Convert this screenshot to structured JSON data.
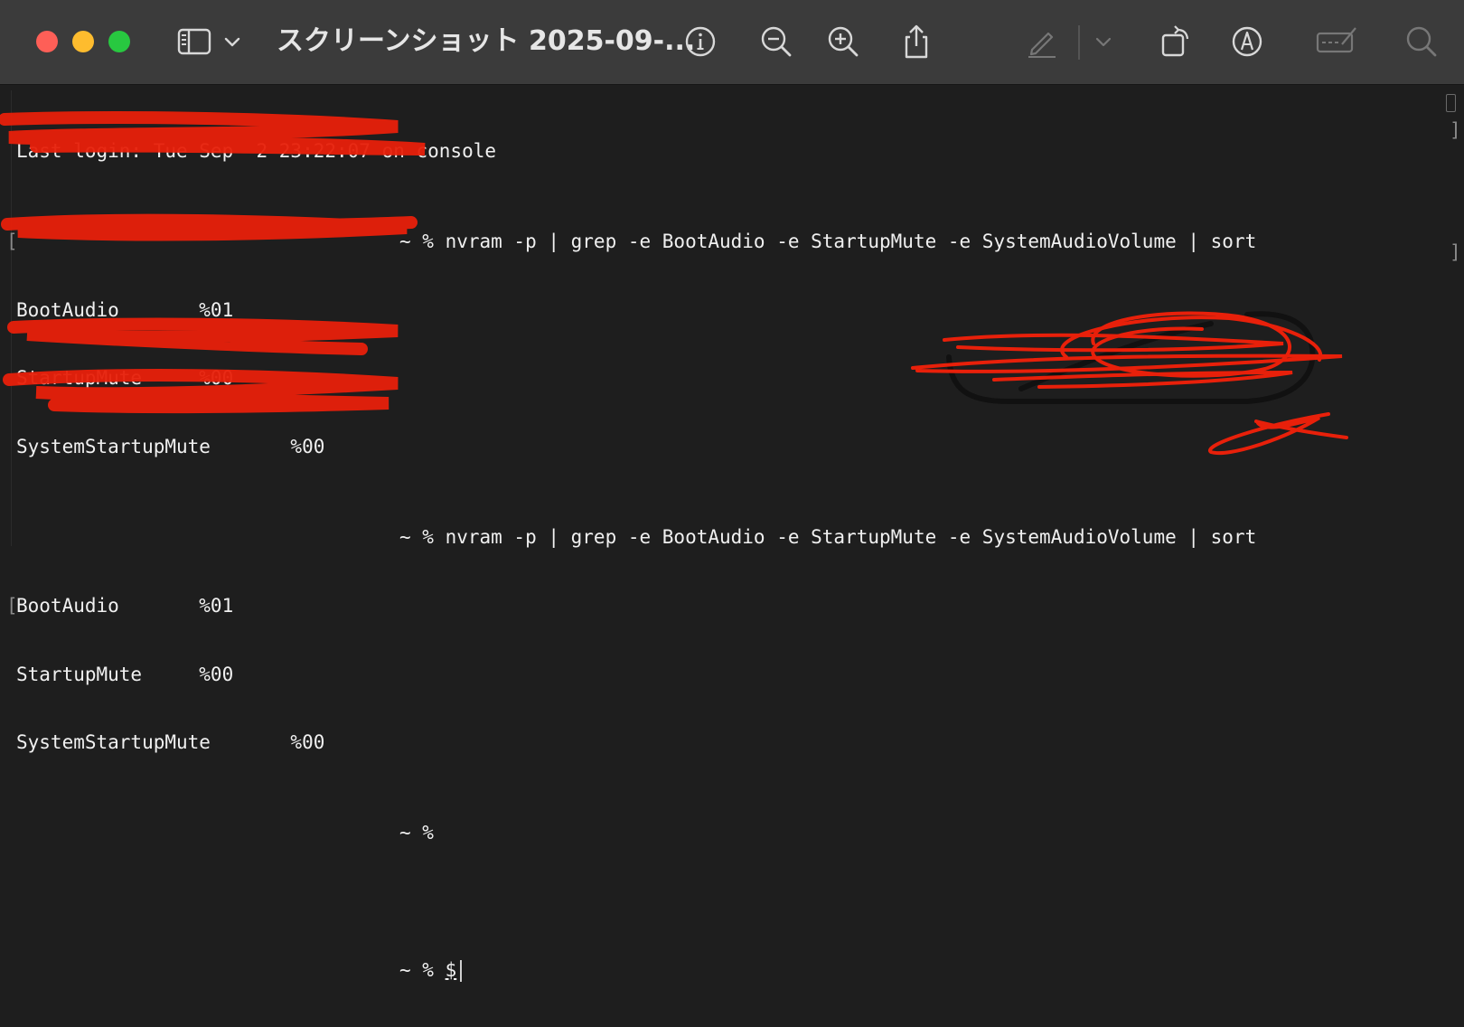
{
  "window": {
    "title": "スクリーンショット 2025-09-..."
  },
  "toolbar": {
    "icons": [
      "sidebar-icon",
      "chevron-down-icon",
      "info-icon",
      "zoom-out-icon",
      "zoom-in-icon",
      "share-icon",
      "markup-pen-icon",
      "chevron-down-icon",
      "rotate-icon",
      "markup-icon",
      "signature-icon",
      "search-icon"
    ]
  },
  "terminal": {
    "last_login": "Last login: Tue Sep  2 23:22:07 on console",
    "command1": "~ % nvram -p | grep -e BootAudio -e StartupMute -e SystemAudioVolume | sort",
    "output1": [
      "BootAudio       %01",
      "StartupMute     %00",
      "SystemStartupMute       %00"
    ],
    "command2": "~ % nvram -p | grep -e BootAudio -e StartupMute -e SystemAudioVolume | sort",
    "output2": [
      "BootAudio       %01",
      "StartupMute     %00",
      "SystemStartupMute       %00"
    ],
    "prompt3": "~ %",
    "prompt4": "~ %",
    "prompt4_dollar": "$"
  },
  "colors": {
    "titlebar": "#3b3b3b",
    "terminal_bg": "#1e1e1e",
    "scribble": "#e8200a"
  }
}
